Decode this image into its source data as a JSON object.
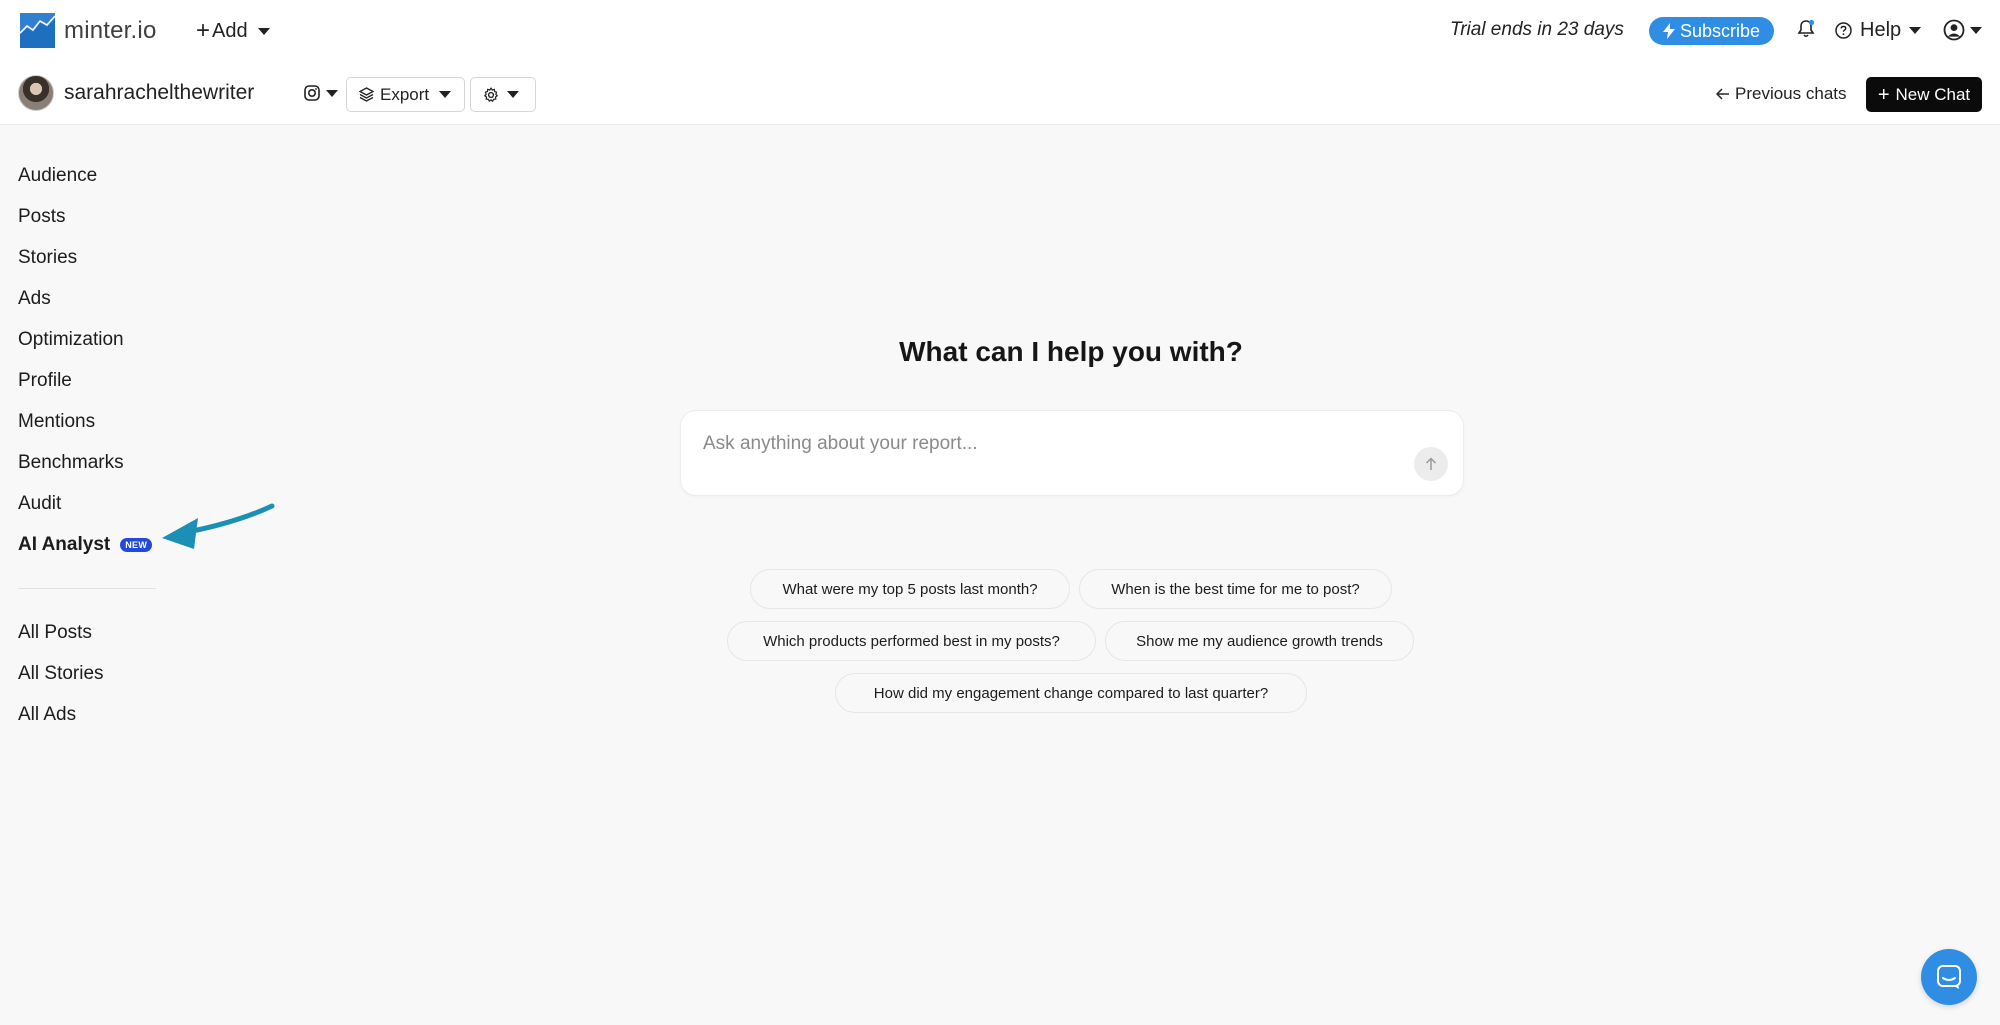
{
  "brand": {
    "name": "minter.io"
  },
  "topbar": {
    "add_label": "Add",
    "trial_text": "Trial ends in 23 days",
    "subscribe_label": "Subscribe",
    "help_label": "Help"
  },
  "account": {
    "username": "sarahrachelthewriter",
    "export_label": "Export",
    "previous_chats_label": "Previous chats",
    "new_chat_label": "New Chat"
  },
  "sidebar": {
    "items": [
      {
        "label": "Audience"
      },
      {
        "label": "Posts"
      },
      {
        "label": "Stories"
      },
      {
        "label": "Ads"
      },
      {
        "label": "Optimization"
      },
      {
        "label": "Profile"
      },
      {
        "label": "Mentions"
      },
      {
        "label": "Benchmarks"
      },
      {
        "label": "Audit"
      },
      {
        "label": "AI Analyst",
        "badge": "NEW",
        "active": true
      }
    ],
    "secondary_items": [
      {
        "label": "All Posts"
      },
      {
        "label": "All Stories"
      },
      {
        "label": "All Ads"
      }
    ]
  },
  "main": {
    "heading": "What can I help you with?",
    "prompt_placeholder": "Ask anything about your report...",
    "suggestions": [
      "What were my top 5 posts last month?",
      "When is the best time for me to post?",
      "Which products performed best in my posts?",
      "Show me my audience growth trends",
      "How did my engagement change compared to last quarter?"
    ]
  },
  "colors": {
    "accent": "#2f8de4",
    "badge": "#2448d8",
    "annotation_arrow": "#1b8fb5",
    "primary_button": "#0b0b0b"
  },
  "icons": [
    "chart-logo-icon",
    "lightning-icon",
    "bell-icon",
    "question-circle-icon",
    "user-circle-icon",
    "instagram-icon",
    "layers-icon",
    "gear-icon",
    "arrow-left-icon",
    "arrow-up-icon",
    "chat-icon"
  ]
}
